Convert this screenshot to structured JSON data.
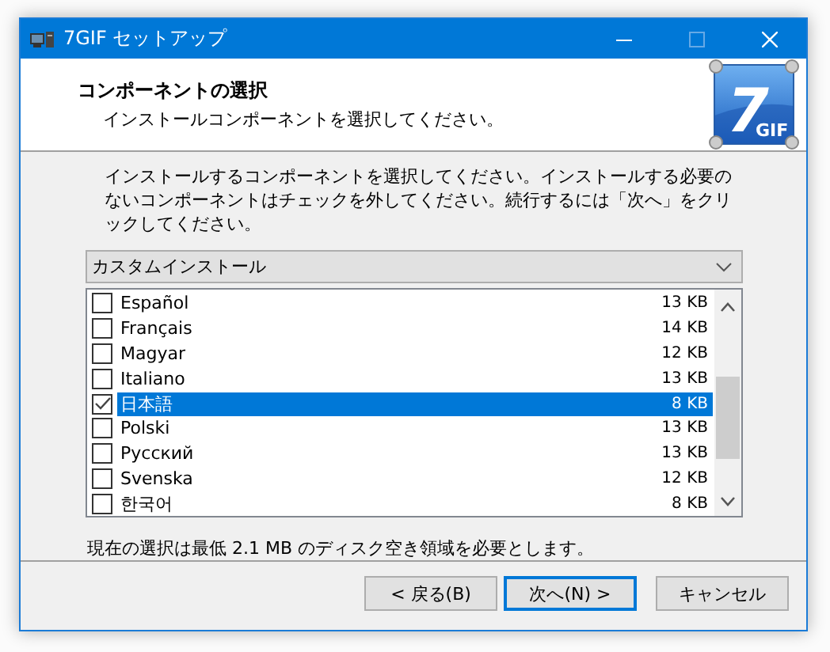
{
  "window": {
    "title": "7GIF セットアップ",
    "maximize_disabled": true
  },
  "header": {
    "title": "コンポーネントの選択",
    "subtitle": "インストールコンポーネントを選択してください。",
    "logo": {
      "large": "7",
      "small": "GIF"
    }
  },
  "instructions": "インストールするコンポーネントを選択してください。インストールする必要のないコンポーネントはチェックを外してください。続行するには「次へ」をクリックしてください。",
  "install_type": {
    "value": "カスタムインストール"
  },
  "components": [
    {
      "name": "Español",
      "size": "13 KB",
      "checked": false,
      "selected": false
    },
    {
      "name": "Français",
      "size": "14 KB",
      "checked": false,
      "selected": false
    },
    {
      "name": "Magyar",
      "size": "12 KB",
      "checked": false,
      "selected": false
    },
    {
      "name": "Italiano",
      "size": "13 KB",
      "checked": false,
      "selected": false
    },
    {
      "name": "日本語",
      "size": "8 KB",
      "checked": true,
      "selected": true
    },
    {
      "name": "Polski",
      "size": "13 KB",
      "checked": false,
      "selected": false
    },
    {
      "name": "Русский",
      "size": "13 KB",
      "checked": false,
      "selected": false
    },
    {
      "name": "Svenska",
      "size": "12 KB",
      "checked": false,
      "selected": false
    },
    {
      "name": "한국어",
      "size": "8 KB",
      "checked": false,
      "selected": false
    }
  ],
  "disk_space_note": "現在の選択は最低 2.1 MB のディスク空き領域を必要とします。",
  "buttons": [
    {
      "label": "< 戻る(B)",
      "kind": "normal"
    },
    {
      "label": "次へ(N) >",
      "kind": "default"
    },
    {
      "label": "キャンセル",
      "kind": "normal"
    }
  ]
}
